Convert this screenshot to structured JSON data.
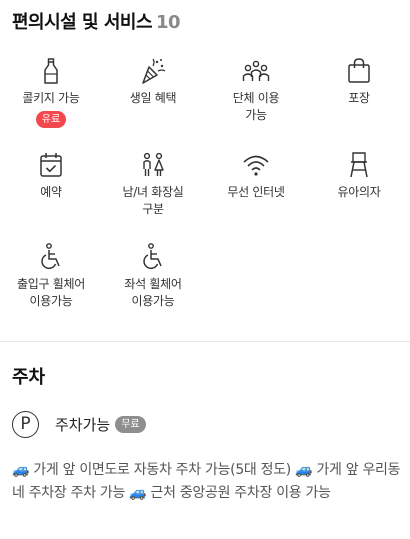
{
  "amenities_section": {
    "title": "편의시설 및 서비스",
    "count": "10",
    "items": [
      {
        "label": "콜키지 가능",
        "badge": "유료",
        "icon": "bottle-icon"
      },
      {
        "label": "생일 혜택",
        "icon": "party-popper-icon"
      },
      {
        "label": "단체 이용\n가능",
        "icon": "group-icon"
      },
      {
        "label": "포장",
        "icon": "shopping-bag-icon"
      },
      {
        "label": "예약",
        "icon": "calendar-check-icon"
      },
      {
        "label": "남/녀 화장실\n구분",
        "icon": "restroom-icon"
      },
      {
        "label": "무선 인터넷",
        "icon": "wifi-icon"
      },
      {
        "label": "유아의자",
        "icon": "high-chair-icon"
      },
      {
        "label": "출입구 휠체어\n이용가능",
        "icon": "wheelchair-icon"
      },
      {
        "label": "좌석 휠체어\n이용가능",
        "icon": "wheelchair-icon"
      }
    ]
  },
  "parking_section": {
    "title": "주차",
    "icon_letter": "P",
    "label": "주차가능",
    "badge": "무료",
    "description": "🚙 가게 앞 이면도로 자동차 주차 가능(5대 정도) 🚙 가게 앞 우리동네 주차장 주차 가능 🚙 근처 중앙공원 주차장 이용 가능"
  }
}
